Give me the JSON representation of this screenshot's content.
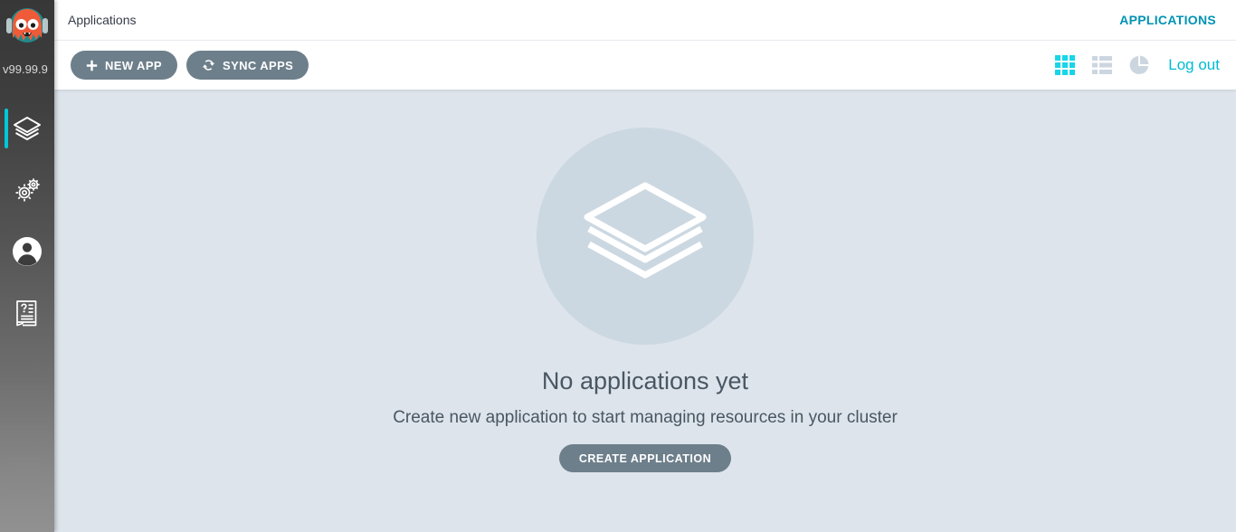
{
  "sidebar": {
    "version_label": "v99.99.9",
    "logo_icon": "argo-octopus-logo",
    "items": [
      {
        "name": "applications",
        "icon": "layers-icon",
        "active": true
      },
      {
        "name": "settings",
        "icon": "gears-icon",
        "active": false
      },
      {
        "name": "user-info",
        "icon": "user-circle-icon",
        "active": false
      },
      {
        "name": "documentation",
        "icon": "help-book-icon",
        "active": false
      }
    ]
  },
  "topbar": {
    "title": "Applications",
    "right_label": "APPLICATIONS"
  },
  "toolbar": {
    "new_app_label": "NEW APP",
    "new_app_icon": "plus-icon",
    "sync_apps_label": "SYNC APPS",
    "sync_apps_icon": "sync-refresh-icon",
    "view_tiles_icon": "tiles-grid-icon",
    "view_list_icon": "list-rows-icon",
    "view_summary_icon": "pie-chart-icon",
    "logout_label": "Log out"
  },
  "empty_state": {
    "illustration_icon": "layers-stack-icon",
    "title": "No applications yet",
    "subtitle": "Create new application to start managing resources in your cluster",
    "cta_label": "CREATE APPLICATION"
  },
  "colors": {
    "accent_teal": "#00bcd4",
    "accent_teal_dark": "#0093b3",
    "button_slate": "#6d7f8b",
    "content_bg": "#dde4eb",
    "circle_bg": "#ccd8e1",
    "sidebar_top": "#373737",
    "sidebar_bottom": "#919191",
    "text_dark": "#495763",
    "view_inactive": "#ccd6e0"
  }
}
